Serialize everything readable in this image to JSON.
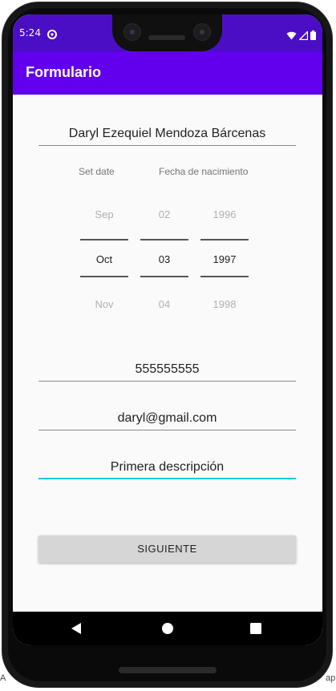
{
  "status_bar": {
    "time": "5:24",
    "bg_color": "#4b0ec4",
    "icons": [
      "app-notification-icon",
      "wifi-icon",
      "signal-icon",
      "battery-icon"
    ]
  },
  "app_bar": {
    "title": "Formulario",
    "bg_color": "#6200ee"
  },
  "form": {
    "name_value": "Daryl Ezequiel Mendoza Bárcenas",
    "set_date_label": "Set date",
    "birth_date_label": "Fecha de nacimiento",
    "date_picker": {
      "month": {
        "prev": "Sep",
        "selected": "Oct",
        "next": "Nov"
      },
      "day": {
        "prev": "02",
        "selected": "03",
        "next": "04"
      },
      "year": {
        "prev": "1996",
        "selected": "1997",
        "next": "1998"
      }
    },
    "phone_value": "555555555",
    "email_value": "daryl@gmail.com",
    "description_value": "Primera descripción",
    "active_field_color": "#26c6da",
    "next_button_label": "SIGUIENTE"
  },
  "nav_bar": {
    "icons": [
      "back-icon",
      "home-icon",
      "recents-icon"
    ]
  },
  "edge": {
    "left_text": "A",
    "right_text": "ap"
  }
}
